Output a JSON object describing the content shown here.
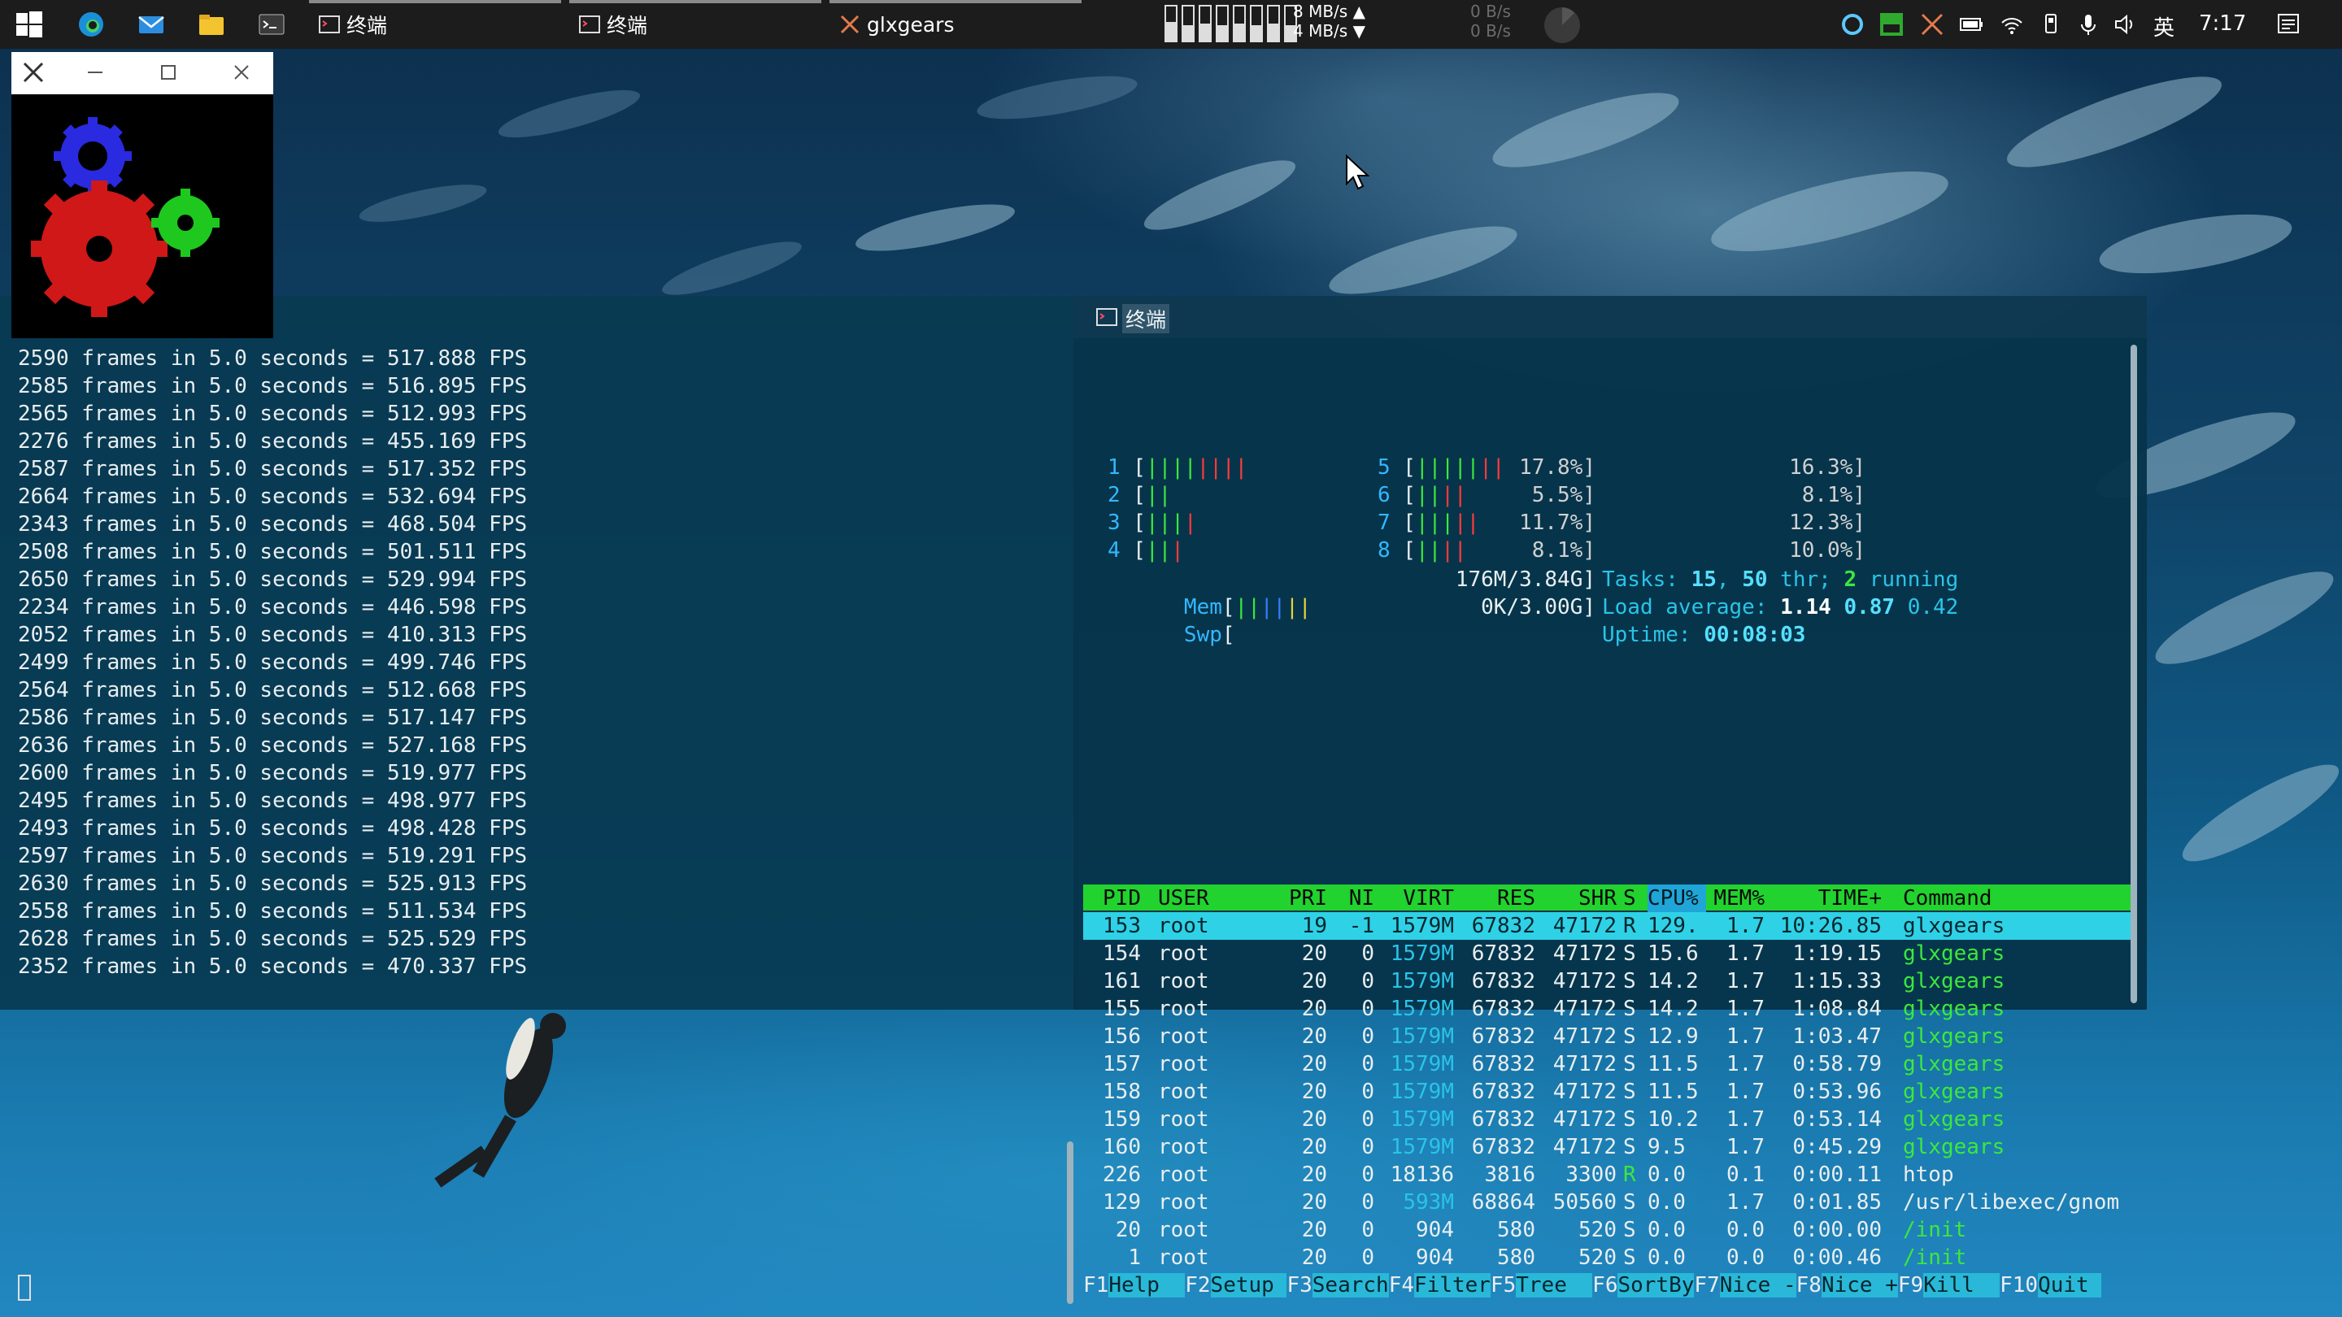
{
  "taskbar": {
    "apps": [
      {
        "label": "终端"
      },
      {
        "label": "终端"
      },
      {
        "label": "glxgears"
      }
    ],
    "net_up": "8 MB/s ▲",
    "net_down": "4 MB/s ▼",
    "net_up2": "0 B/s",
    "net_down2": "0 B/s",
    "ime": "英",
    "clock": "7:17",
    "core_levels": [
      0.55,
      0.45,
      0.5,
      0.45,
      0.5,
      0.45,
      0.5,
      0.45
    ]
  },
  "term1": {
    "lines": [
      "2590 frames in 5.0 seconds = 517.888 FPS",
      "2585 frames in 5.0 seconds = 516.895 FPS",
      "2565 frames in 5.0 seconds = 512.993 FPS",
      "2276 frames in 5.0 seconds = 455.169 FPS",
      "2587 frames in 5.0 seconds = 517.352 FPS",
      "2664 frames in 5.0 seconds = 532.694 FPS",
      "2343 frames in 5.0 seconds = 468.504 FPS",
      "2508 frames in 5.0 seconds = 501.511 FPS",
      "2650 frames in 5.0 seconds = 529.994 FPS",
      "2234 frames in 5.0 seconds = 446.598 FPS",
      "2052 frames in 5.0 seconds = 410.313 FPS",
      "2499 frames in 5.0 seconds = 499.746 FPS",
      "2564 frames in 5.0 seconds = 512.668 FPS",
      "2586 frames in 5.0 seconds = 517.147 FPS",
      "2636 frames in 5.0 seconds = 527.168 FPS",
      "2600 frames in 5.0 seconds = 519.977 FPS",
      "2495 frames in 5.0 seconds = 498.977 FPS",
      "2493 frames in 5.0 seconds = 498.428 FPS",
      "2597 frames in 5.0 seconds = 519.291 FPS",
      "2630 frames in 5.0 seconds = 525.913 FPS",
      "2558 frames in 5.0 seconds = 511.534 FPS",
      "2628 frames in 5.0 seconds = 525.529 FPS",
      "2352 frames in 5.0 seconds = 470.337 FPS"
    ]
  },
  "term2": {
    "title": "终端"
  },
  "htop": {
    "cpus_left": [
      {
        "num": "1",
        "bars": "||||||||",
        "green": 4,
        "pct": "17.8%]"
      },
      {
        "num": "2",
        "bars": "||",
        "green": 2,
        "pct": "5.5%]"
      },
      {
        "num": "3",
        "bars": "||||",
        "green": 3,
        "pct": "11.7%]"
      },
      {
        "num": "4",
        "bars": "|||",
        "green": 2,
        "pct": "8.1%]"
      }
    ],
    "cpus_right": [
      {
        "num": "5",
        "bars": "|||||||",
        "green": 5,
        "pct": "16.3%]"
      },
      {
        "num": "6",
        "bars": "||||",
        "green": 2,
        "pct": "8.1%]"
      },
      {
        "num": "7",
        "bars": "|||||",
        "green": 3,
        "pct": "12.3%]"
      },
      {
        "num": "8",
        "bars": "||||",
        "green": 2,
        "pct": "10.0%]"
      }
    ],
    "mem_label": "Mem",
    "mem_value": "176M/3.84G]",
    "swp_label": "Swp",
    "swp_value": "0K/3.00G]",
    "tasks_label": "Tasks: ",
    "tasks_count": "15",
    "tasks_sep": ", ",
    "tasks_thr": "50",
    "tasks_thr_label": " thr; ",
    "tasks_running": "2",
    "tasks_running_label": " running",
    "load_label": "Load average: ",
    "load1": "1.14",
    "load5": "0.87",
    "load15": "0.42",
    "uptime_label": "Uptime: ",
    "uptime": "00:08:03",
    "columns": {
      "pid": "PID",
      "user": "USER",
      "pri": "PRI",
      "ni": "NI",
      "virt": "VIRT",
      "res": "RES",
      "shr": "SHR",
      "s": "S",
      "cpu": "CPU%",
      "mem": "MEM%",
      "time": "TIME+",
      "command": "Command"
    },
    "processes": [
      {
        "pid": "153",
        "user": "root",
        "pri": "19",
        "ni": "-1",
        "virt": "1579M",
        "res": "67832",
        "shr": "47172",
        "s": "R",
        "cpu": "129.",
        "mem": "1.7",
        "time": "10:26.85",
        "command": "glxgears"
      },
      {
        "pid": "154",
        "user": "root",
        "pri": "20",
        "ni": "0",
        "virt": "1579M",
        "res": "67832",
        "shr": "47172",
        "s": "S",
        "cpu": "15.6",
        "mem": "1.7",
        "time": "1:19.15",
        "command": "glxgears"
      },
      {
        "pid": "161",
        "user": "root",
        "pri": "20",
        "ni": "0",
        "virt": "1579M",
        "res": "67832",
        "shr": "47172",
        "s": "S",
        "cpu": "14.2",
        "mem": "1.7",
        "time": "1:15.33",
        "command": "glxgears"
      },
      {
        "pid": "155",
        "user": "root",
        "pri": "20",
        "ni": "0",
        "virt": "1579M",
        "res": "67832",
        "shr": "47172",
        "s": "S",
        "cpu": "14.2",
        "mem": "1.7",
        "time": "1:08.84",
        "command": "glxgears"
      },
      {
        "pid": "156",
        "user": "root",
        "pri": "20",
        "ni": "0",
        "virt": "1579M",
        "res": "67832",
        "shr": "47172",
        "s": "S",
        "cpu": "12.9",
        "mem": "1.7",
        "time": "1:03.47",
        "command": "glxgears"
      },
      {
        "pid": "157",
        "user": "root",
        "pri": "20",
        "ni": "0",
        "virt": "1579M",
        "res": "67832",
        "shr": "47172",
        "s": "S",
        "cpu": "11.5",
        "mem": "1.7",
        "time": "0:58.79",
        "command": "glxgears"
      },
      {
        "pid": "158",
        "user": "root",
        "pri": "20",
        "ni": "0",
        "virt": "1579M",
        "res": "67832",
        "shr": "47172",
        "s": "S",
        "cpu": "11.5",
        "mem": "1.7",
        "time": "0:53.96",
        "command": "glxgears"
      },
      {
        "pid": "159",
        "user": "root",
        "pri": "20",
        "ni": "0",
        "virt": "1579M",
        "res": "67832",
        "shr": "47172",
        "s": "S",
        "cpu": "10.2",
        "mem": "1.7",
        "time": "0:53.14",
        "command": "glxgears"
      },
      {
        "pid": "160",
        "user": "root",
        "pri": "20",
        "ni": "0",
        "virt": "1579M",
        "res": "67832",
        "shr": "47172",
        "s": "S",
        "cpu": "9.5",
        "mem": "1.7",
        "time": "0:45.29",
        "command": "glxgears"
      },
      {
        "pid": "226",
        "user": "root",
        "pri": "20",
        "ni": "0",
        "virt": "18136",
        "res": "3816",
        "shr": "3300",
        "s": "R",
        "cpu": "0.0",
        "mem": "0.1",
        "time": "0:00.11",
        "command": "htop"
      },
      {
        "pid": "129",
        "user": "root",
        "pri": "20",
        "ni": "0",
        "virt": "593M",
        "res": "68864",
        "shr": "50560",
        "s": "S",
        "cpu": "0.0",
        "mem": "1.7",
        "time": "0:01.85",
        "command": "/usr/libexec/gnom"
      },
      {
        "pid": "20",
        "user": "root",
        "pri": "20",
        "ni": "0",
        "virt": "904",
        "res": "580",
        "shr": "520",
        "s": "S",
        "cpu": "0.0",
        "mem": "0.0",
        "time": "0:00.00",
        "command": "/init"
      },
      {
        "pid": "1",
        "user": "root",
        "pri": "20",
        "ni": "0",
        "virt": "904",
        "res": "580",
        "shr": "520",
        "s": "S",
        "cpu": "0.0",
        "mem": "0.0",
        "time": "0:00.46",
        "command": "/init"
      }
    ],
    "footer": [
      {
        "key": "F1",
        "label": "Help  "
      },
      {
        "key": "F2",
        "label": "Setup "
      },
      {
        "key": "F3",
        "label": "Search"
      },
      {
        "key": "F4",
        "label": "Filter"
      },
      {
        "key": "F5",
        "label": "Tree  "
      },
      {
        "key": "F6",
        "label": "SortBy"
      },
      {
        "key": "F7",
        "label": "Nice -"
      },
      {
        "key": "F8",
        "label": "Nice +"
      },
      {
        "key": "F9",
        "label": "Kill  "
      },
      {
        "key": "F10",
        "label": "Quit "
      }
    ]
  }
}
